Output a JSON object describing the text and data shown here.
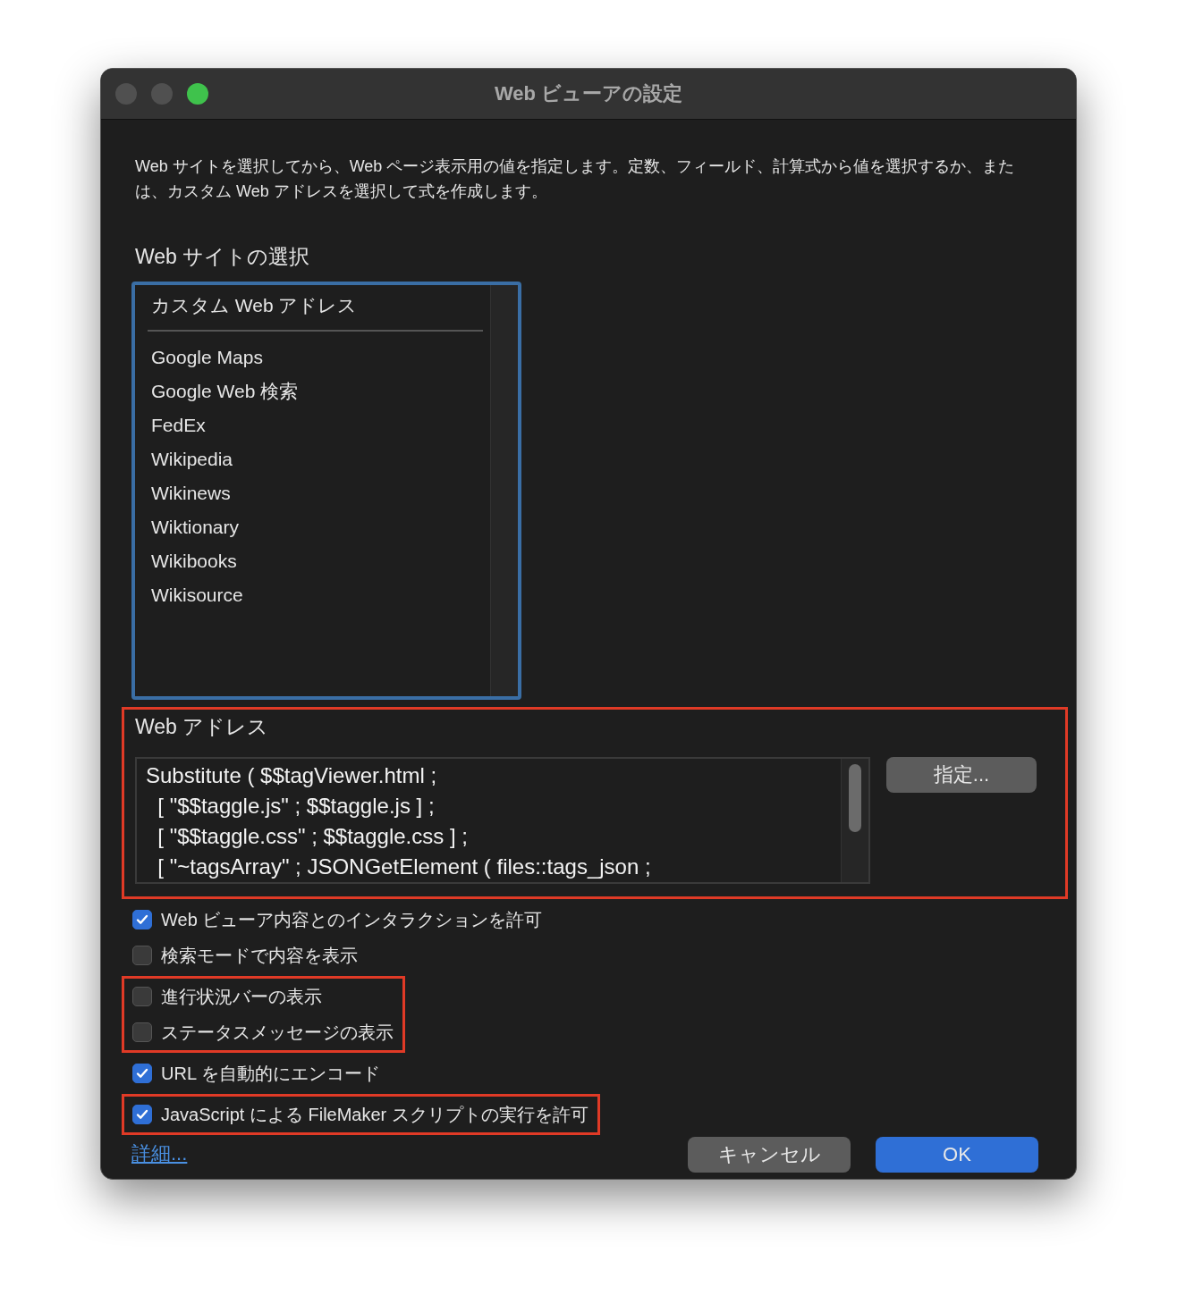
{
  "window": {
    "title": "Web ビューアの設定",
    "controls": [
      {
        "kind": "close"
      },
      {
        "kind": "minimize"
      },
      {
        "kind": "zoom"
      }
    ]
  },
  "description": "Web サイトを選択してから、Web ページ表示用の値を指定します。定数、フィールド、計算式から値を選択するか、または、カスタム Web アドレスを選択して式を作成します。",
  "website_section": {
    "title": "Web サイトの選択",
    "focused": true,
    "items": [
      {
        "kind": "item",
        "label": "カスタム Web アドレス"
      },
      {
        "kind": "separator"
      },
      {
        "kind": "item",
        "label": "Google Maps"
      },
      {
        "kind": "item",
        "label": "Google Web 検索"
      },
      {
        "kind": "item",
        "label": "FedEx"
      },
      {
        "kind": "item",
        "label": "Wikipedia"
      },
      {
        "kind": "item",
        "label": "Wikinews"
      },
      {
        "kind": "item",
        "label": "Wiktionary"
      },
      {
        "kind": "item",
        "label": "Wikibooks"
      },
      {
        "kind": "item",
        "label": "Wikisource"
      }
    ]
  },
  "address_section": {
    "title": "Web アドレス",
    "highlighted": true,
    "formula_lines": [
      "Substitute ( $$tagViewer.html ;",
      "  [ \"$$taggle.js\" ; $$taggle.js ] ;",
      "  [ \"$$taggle.css\" ; $$taggle.css ] ;",
      "  [ \"~tagsArray\" ; JSONGetElement ( files::tags_json ;"
    ],
    "specify_button": "指定..."
  },
  "option_groups": [
    {
      "highlighted": false,
      "options": [
        {
          "label": "Web ビューア内容とのインタラクションを許可",
          "checked": true
        },
        {
          "label": "検索モードで内容を表示",
          "checked": false
        }
      ]
    },
    {
      "highlighted": true,
      "options": [
        {
          "label": "進行状況バーの表示",
          "checked": false
        },
        {
          "label": "ステータスメッセージの表示",
          "checked": false
        }
      ]
    },
    {
      "highlighted": false,
      "options": [
        {
          "label": "URL を自動的にエンコード",
          "checked": true
        }
      ]
    },
    {
      "highlighted": true,
      "options": [
        {
          "label": "JavaScript による FileMaker スクリプトの実行を許可",
          "checked": true
        }
      ]
    }
  ],
  "details_link": "詳細...",
  "buttons": [
    {
      "label": "キャンセル",
      "kind": "secondary"
    },
    {
      "label": "OK",
      "kind": "primary"
    }
  ]
}
